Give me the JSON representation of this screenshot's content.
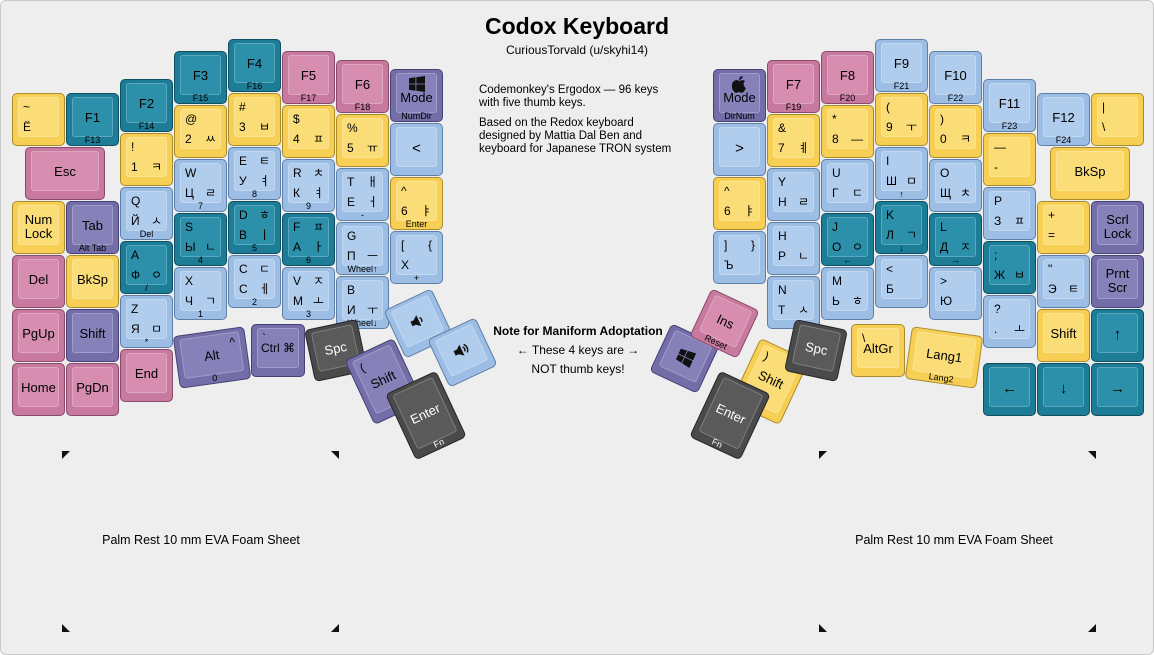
{
  "title": "Codox Keyboard",
  "subtitle": "CuriousTorvald (u/skyhi14)",
  "description": [
    "Codemonkey's Ergodox — 96 keys with five thumb keys.",
    "Based on the Redox keyboard designed by Mattia Dal Ben and keyboard for Japanese TRON system"
  ],
  "note": {
    "title": "Note for Maniform Adoptation",
    "line1": "← These 4 keys are →",
    "line2": "NOT thumb keys!"
  },
  "palm_left": "Palm Rest 10 mm EVA Foam Sheet",
  "palm_right": "Palm Rest 10 mm EVA Foam Sheet",
  "colors": {
    "yellow": "#f7cf55",
    "teal": "#1d7d97",
    "blue": "#9cbde4",
    "pink": "#c8799f",
    "purple": "#736da8",
    "dark": "#4a4a4a",
    "board": "#eeeeee"
  },
  "keys": [
    {
      "id": "tilde",
      "c": "yellow",
      "tl": "~",
      "bl": "Ё"
    },
    {
      "id": "f1",
      "c": "teal",
      "c1": "F1",
      "f": "F13"
    },
    {
      "id": "f2",
      "c": "teal",
      "c1": "F2",
      "f": "F14"
    },
    {
      "id": "f3",
      "c": "teal",
      "c1": "F3",
      "f": "F15"
    },
    {
      "id": "f4",
      "c": "teal",
      "c1": "F4",
      "f": "F16"
    },
    {
      "id": "f5",
      "c": "pink",
      "c1": "F5",
      "f": "F17"
    },
    {
      "id": "f6",
      "c": "pink",
      "c1": "F6",
      "f": "F18"
    },
    {
      "id": "mode-left",
      "c": "purple",
      "icon": "windows-icon",
      "c1": "Mode",
      "f": "NumDir"
    },
    {
      "id": "esc",
      "c": "pink",
      "c1": "Esc"
    },
    {
      "id": "k1",
      "c": "yellow",
      "tl": "!",
      "bl": "1",
      "br": "ㅋ"
    },
    {
      "id": "k2",
      "c": "yellow",
      "tl": "@",
      "bl": "2",
      "br": "ㅆ"
    },
    {
      "id": "k3",
      "c": "yellow",
      "tl": "#",
      "bl": "3",
      "br": "ㅂ"
    },
    {
      "id": "k4",
      "c": "yellow",
      "tl": "$",
      "bl": "4",
      "br": "ㅍ"
    },
    {
      "id": "k5",
      "c": "yellow",
      "tl": "%",
      "bl": "5",
      "br": "ㅠ"
    },
    {
      "id": "lt",
      "c": "blue",
      "c1": "<"
    },
    {
      "id": "numlock",
      "c": "yellow",
      "c1": "Num",
      "c2": "Lock"
    },
    {
      "id": "tab",
      "c": "purple",
      "c1": "Tab",
      "f": "Alt Tab"
    },
    {
      "id": "q",
      "c": "blue",
      "tl": "Q",
      "bl": "Й",
      "br": "ㅅ",
      "f": "Del"
    },
    {
      "id": "w",
      "c": "blue",
      "tl": "W",
      "bl": "Ц",
      "br": "ㄹ",
      "f": "7"
    },
    {
      "id": "e",
      "c": "blue",
      "tl": "E",
      "bl": "У",
      "br": "ㅕ",
      "tr": "ㅌ",
      "f": "8"
    },
    {
      "id": "r",
      "c": "blue",
      "tl": "R",
      "bl": "К",
      "br": "ㅕ",
      "tr": "ㅊ",
      "f": "9"
    },
    {
      "id": "t",
      "c": "blue",
      "tl": "T",
      "bl": "Е",
      "br": "ㅓ",
      "tr": "ㅐ",
      "f": "-"
    },
    {
      "id": "caret-left",
      "c": "yellow",
      "tl": "^",
      "bl": "6",
      "br": "ㅑ",
      "f": "Enter"
    },
    {
      "id": "del",
      "c": "pink",
      "c1": "Del"
    },
    {
      "id": "bksp-left",
      "c": "yellow",
      "c1": "BkSp"
    },
    {
      "id": "a",
      "c": "teal",
      "tl": "A",
      "bl": "Ф",
      "br": "ㅇ",
      "f": "/"
    },
    {
      "id": "s",
      "c": "teal",
      "tl": "S",
      "bl": "Ы",
      "br": "ㄴ",
      "f": "4"
    },
    {
      "id": "d",
      "c": "teal",
      "tl": "D",
      "bl": "В",
      "br": "ㅣ",
      "tr": "ㅎ",
      "f": "5"
    },
    {
      "id": "f",
      "c": "teal",
      "tl": "F",
      "bl": "А",
      "br": "ㅏ",
      "tr": "ㅍ",
      "f": "6"
    },
    {
      "id": "g",
      "c": "blue",
      "tl": "G",
      "bl": "П",
      "br": "ㅡ",
      "f": "Wheel↑"
    },
    {
      "id": "bracket-left",
      "c": "blue",
      "tl": "[",
      "tr": "{",
      "bl": "Х",
      "f": "+"
    },
    {
      "id": "pgup",
      "c": "pink",
      "c1": "PgUp"
    },
    {
      "id": "shift-left",
      "c": "purple",
      "c1": "Shift"
    },
    {
      "id": "z",
      "c": "blue",
      "tl": "Z",
      "bl": "Я",
      "br": "ㅁ",
      "f": "*"
    },
    {
      "id": "x",
      "c": "blue",
      "tl": "X",
      "bl": "Ч",
      "br": "ㄱ",
      "f": "1"
    },
    {
      "id": "cc",
      "c": "blue",
      "tl": "C",
      "bl": "С",
      "br": "ㅔ",
      "tr": "ㄷ",
      "f": "2"
    },
    {
      "id": "v",
      "c": "blue",
      "tl": "V",
      "bl": "М",
      "br": "ㅗ",
      "tr": "ㅈ",
      "f": "3"
    },
    {
      "id": "b",
      "c": "blue",
      "tl": "B",
      "bl": "И",
      "br": "ㅜ",
      "f": "Wheel↓"
    },
    {
      "id": "home",
      "c": "pink",
      "c1": "Home"
    },
    {
      "id": "pgdn",
      "c": "pink",
      "c1": "PgDn"
    },
    {
      "id": "end",
      "c": "pink",
      "c1": "End"
    },
    {
      "id": "alt",
      "c": "purple",
      "c1": "Alt",
      "tr": "^",
      "f": "0"
    },
    {
      "id": "ctrl",
      "c": "purple",
      "c1": "Ctrl ⌘",
      "tl": "`"
    },
    {
      "id": "spc-left",
      "c": "dark",
      "c1": "Spc"
    },
    {
      "id": "shift-thumb-left",
      "c": "purple",
      "c1": "Shift",
      "tl": "("
    },
    {
      "id": "enter-left",
      "c": "dark",
      "c1": "Enter",
      "f": "Fn"
    },
    {
      "id": "vol-down",
      "c": "blue",
      "icon": "volume-down-icon"
    },
    {
      "id": "vol-up",
      "c": "blue",
      "icon": "volume-up-icon"
    },
    {
      "id": "mode-right",
      "c": "purple",
      "icon": "apple-icon",
      "c1": "Mode",
      "f": "DirNum"
    },
    {
      "id": "f7",
      "c": "pink",
      "c1": "F7",
      "f": "F19"
    },
    {
      "id": "f8",
      "c": "pink",
      "c1": "F8",
      "f": "F20"
    },
    {
      "id": "f9",
      "c": "blue",
      "c1": "F9",
      "f": "F21"
    },
    {
      "id": "f10",
      "c": "blue",
      "c1": "F10",
      "f": "F22"
    },
    {
      "id": "f11",
      "c": "blue",
      "c1": "F11",
      "f": "F23"
    },
    {
      "id": "f12",
      "c": "blue",
      "c1": "F12",
      "f": "F24"
    },
    {
      "id": "pipe",
      "c": "yellow",
      "tl": "|",
      "bl": "\\"
    },
    {
      "id": "gt",
      "c": "blue",
      "c1": ">"
    },
    {
      "id": "k7",
      "c": "yellow",
      "tl": "&",
      "bl": "7",
      "br": "ㅖ"
    },
    {
      "id": "k8",
      "c": "yellow",
      "tl": "*",
      "bl": "8",
      "br": "—"
    },
    {
      "id": "k9",
      "c": "yellow",
      "tl": "(",
      "bl": "9",
      "br": "ㅜ"
    },
    {
      "id": "k0",
      "c": "yellow",
      "tl": ")",
      "bl": "0",
      "br": "ㅋ"
    },
    {
      "id": "minus",
      "c": "yellow",
      "tl": "—",
      "bl": "-"
    },
    {
      "id": "bksp-right",
      "c": "yellow",
      "c1": "BkSp"
    },
    {
      "id": "caret-right",
      "c": "yellow",
      "tl": "^",
      "bl": "6",
      "br": "ㅑ"
    },
    {
      "id": "y",
      "c": "blue",
      "tl": "Y",
      "bl": "Н",
      "br": "ㄹ"
    },
    {
      "id": "u",
      "c": "blue",
      "tl": "U",
      "bl": "Г",
      "br": "ㄷ"
    },
    {
      "id": "i",
      "c": "blue",
      "tl": "I",
      "bl": "Ш",
      "br": "ㅁ",
      "f": "↑"
    },
    {
      "id": "o",
      "c": "blue",
      "tl": "O",
      "bl": "Щ",
      "br": "ㅊ"
    },
    {
      "id": "p",
      "c": "blue",
      "tl": "P",
      "bl": "З",
      "br": "ㅍ"
    },
    {
      "id": "plus",
      "c": "yellow",
      "tl": "+",
      "bl": "="
    },
    {
      "id": "scrlock",
      "c": "purple",
      "c1": "Scrl",
      "c2": "Lock"
    },
    {
      "id": "rbracket",
      "c": "blue",
      "tl": "]",
      "tr": "}",
      "bl": "Ъ"
    },
    {
      "id": "h",
      "c": "blue",
      "tl": "H",
      "bl": "Р",
      "br": "ㄴ"
    },
    {
      "id": "j",
      "c": "teal",
      "tl": "J",
      "bl": "О",
      "br": "ㅇ",
      "f": "←"
    },
    {
      "id": "k",
      "c": "teal",
      "tl": "K",
      "bl": "Л",
      "br": "ㄱ",
      "f": "↓"
    },
    {
      "id": "l",
      "c": "teal",
      "tl": "L",
      "bl": "Д",
      "br": "ㅈ",
      "f": "→"
    },
    {
      "id": "semicolon",
      "c": "teal",
      "tl": ";",
      "bl": "Ж",
      "br": "ㅂ"
    },
    {
      "id": "quote",
      "c": "blue",
      "tl": "\"",
      "bl": "Э",
      "br": "ㅌ"
    },
    {
      "id": "prtscr",
      "c": "purple",
      "c1": "Prnt",
      "c2": "Scr"
    },
    {
      "id": "n",
      "c": "blue",
      "tl": "N",
      "bl": "Т",
      "br": "ㅅ"
    },
    {
      "id": "m",
      "c": "blue",
      "tl": "M",
      "bl": "Ь",
      "br": "ㅎ"
    },
    {
      "id": "comma",
      "c": "blue",
      "tl": "<",
      "bl": "Б"
    },
    {
      "id": "period",
      "c": "blue",
      "tl": ">",
      "bl": "Ю"
    },
    {
      "id": "slash",
      "c": "blue",
      "tl": "?",
      "bl": ".",
      "br": "ㅗ"
    },
    {
      "id": "shift-right",
      "c": "yellow",
      "c1": "Shift"
    },
    {
      "id": "up",
      "c": "teal",
      "c1": "↑"
    },
    {
      "id": "win-right",
      "c": "purple",
      "icon": "windows-icon"
    },
    {
      "id": "ins",
      "c": "pink",
      "c1": "Ins",
      "f": "Reset"
    },
    {
      "id": "shift-thumb-right",
      "c": "yellow",
      "c1": "Shift",
      "tl": ")"
    },
    {
      "id": "enter-right",
      "c": "dark",
      "c1": "Enter",
      "f": "Fn"
    },
    {
      "id": "spc-right",
      "c": "dark",
      "c1": "Spc"
    },
    {
      "id": "altgr",
      "c": "yellow",
      "c1": "AltGr",
      "tl": "\\"
    },
    {
      "id": "lang1",
      "c": "yellow",
      "c1": "Lang1",
      "f": "Lang2"
    },
    {
      "id": "left",
      "c": "teal",
      "c1": "←"
    },
    {
      "id": "down",
      "c": "teal",
      "c1": "↓"
    },
    {
      "id": "right",
      "c": "teal",
      "c1": "→"
    }
  ]
}
